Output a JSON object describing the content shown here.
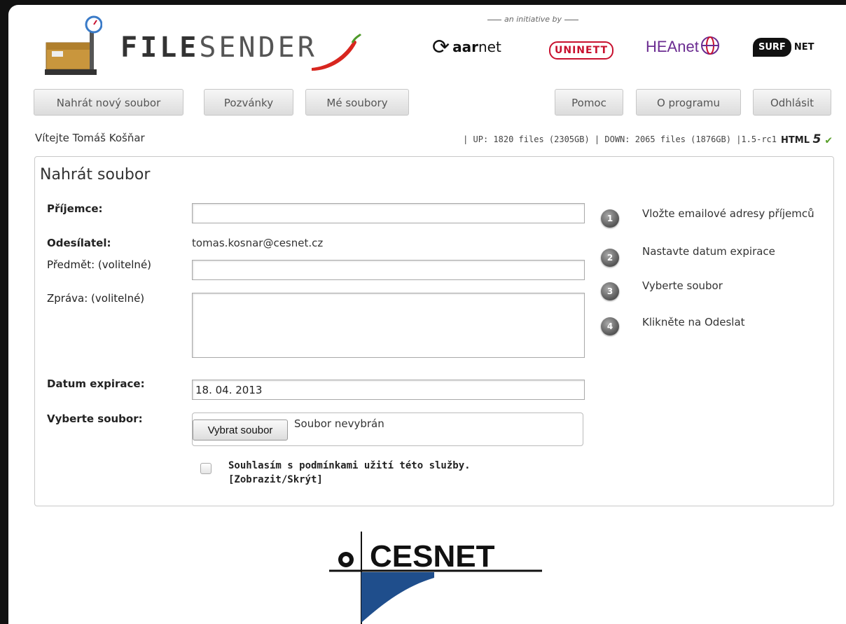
{
  "header": {
    "logo_text_bold": "FILE",
    "logo_text_light": "SENDER",
    "initiative": "an initiative by",
    "partners": {
      "aarnet_bold": "aar",
      "aarnet_rest": "net",
      "uninett": "UNINETT",
      "heanet": "HEAnet",
      "surf": "SURF",
      "net": "NET"
    }
  },
  "nav": {
    "upload": "Nahrát nový soubor",
    "invitations": "Pozvánky",
    "my_files": "Mé soubory",
    "help": "Pomoc",
    "about": "O programu",
    "logout": "Odhlásit"
  },
  "welcome": "Vítejte Tomáš Košňar",
  "stats": "| UP: 1820 files (2305GB) | DOWN: 2065 files (1876GB) |1.5-rc1",
  "html5_label": "HTML",
  "html5_five": "5",
  "form": {
    "title": "Nahrát soubor",
    "recipient_label": "Příjemce:",
    "recipient_value": "",
    "sender_label": "Odesílatel:",
    "sender_value": "tomas.kosnar@cesnet.cz",
    "subject_label": "Předmět: (volitelné)",
    "subject_value": "",
    "message_label": "Zpráva: (volitelné)",
    "message_value": "",
    "expiry_label": "Datum expirace:",
    "expiry_value": "18. 04. 2013",
    "file_label": "Vyberte soubor:",
    "file_button": "Vybrat soubor",
    "file_status": "Soubor nevybrán",
    "terms_text": "Souhlasím s podmínkami užití této služby.",
    "terms_toggle": "[Zobrazit/Skrýt]",
    "terms_checked": false
  },
  "steps": [
    {
      "num": "1",
      "text": "Vložte emailové adresy příjemců"
    },
    {
      "num": "2",
      "text": "Nastavte datum expirace"
    },
    {
      "num": "3",
      "text": "Vyberte soubor"
    },
    {
      "num": "4",
      "text": "Klikněte na Odeslat"
    }
  ],
  "footer": {
    "logo": "CESNET"
  },
  "colors": {
    "accent_red": "#c8102e",
    "heanet_purple": "#6b2c91",
    "check_green": "#5aa02c",
    "cesnet_blue": "#1f4e8c"
  }
}
